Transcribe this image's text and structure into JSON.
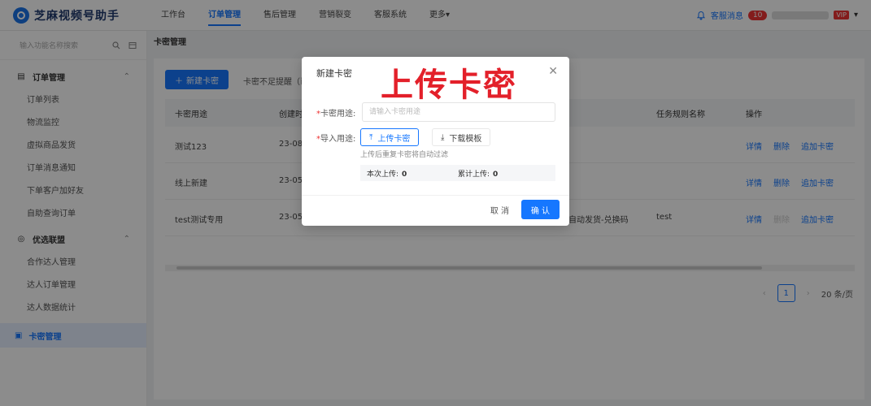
{
  "app": {
    "name": "芝麻视频号助手"
  },
  "topnav": {
    "items": [
      "工作台",
      "订单管理",
      "售后管理",
      "营销裂变",
      "客服系统",
      "更多"
    ],
    "active_index": 1,
    "more_caret": "▾"
  },
  "topright": {
    "message_label": "客服消息",
    "message_count": "10",
    "vip": "VIP"
  },
  "sidebar": {
    "search_placeholder": "输入功能名称搜索",
    "groups": [
      {
        "title": "订单管理",
        "items": [
          "订单列表",
          "物流监控",
          "虚拟商品发货",
          "订单消息通知",
          "下单客户加好友",
          "自助查询订单"
        ]
      },
      {
        "title": "优选联盟",
        "items": [
          "合作达人管理",
          "达人订单管理",
          "达人数据统计"
        ]
      }
    ],
    "active_item": "卡密管理"
  },
  "main": {
    "title": "卡密管理",
    "new_button": "新建卡密",
    "hint": "卡密不足提醒（已",
    "table": {
      "headers": [
        "卡密用途",
        "创建时",
        "",
        "任务规则名称",
        "操作"
      ],
      "rows": [
        {
          "purpose": "测试123",
          "created": "23-08-",
          "task": "",
          "ops": [
            "详情",
            "删除",
            "追加卡密"
          ]
        },
        {
          "purpose": "线上新建",
          "created": "23-05-",
          "task": "",
          "ops": [
            "详情",
            "删除",
            "追加卡密"
          ]
        },
        {
          "purpose": "test测试专用",
          "created": "23-05-",
          "middle": "自动发货-兑换码",
          "task": "test",
          "ops": [
            "详情",
            "删除",
            "追加卡密"
          ]
        }
      ]
    },
    "pager": {
      "prev": "‹",
      "page": "1",
      "next": "›",
      "page_size": "20 条/页"
    }
  },
  "modal": {
    "title": "新建卡密",
    "annotation": "上传卡密",
    "purpose_label": "卡密用途:",
    "purpose_placeholder": "请输入卡密用途",
    "import_label": "导入用途:",
    "upload_button": "上传卡密",
    "download_button": "下载模板",
    "dup_note": "上传后重复卡密将自动过滤",
    "this_upload_label": "本次上传:",
    "this_upload_value": "0",
    "total_upload_label": "累计上传:",
    "total_upload_value": "0",
    "cancel": "取 消",
    "confirm": "确 认"
  },
  "colors": {
    "primary": "#1677ff",
    "annotation": "#e3202a",
    "danger": "#ee3333"
  }
}
